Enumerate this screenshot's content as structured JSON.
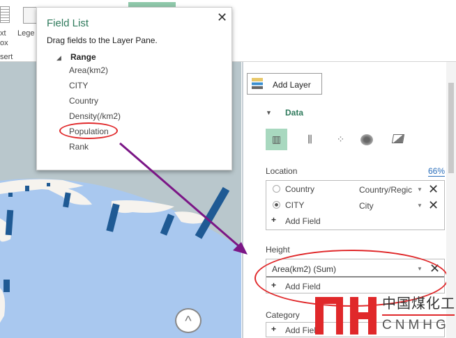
{
  "ribbon": {
    "text_box_label_1": "xt",
    "text_box_label_2": "ox",
    "legend_label": "Lege",
    "group_label": "sert"
  },
  "field_list": {
    "title": "Field List",
    "close": "✕",
    "description": "Drag fields to the Layer Pane.",
    "table_name": "Range",
    "fields": [
      "Area(km2)",
      "CITY",
      "Country",
      "Density(/km2)",
      "Population",
      "Rank"
    ]
  },
  "layer_pane": {
    "add_layer": "Add Layer",
    "data_section": "Data",
    "location_label": "Location",
    "location_confidence": "66%",
    "location_fields": [
      {
        "name": "Country",
        "type": "Country/Regic",
        "selected": false
      },
      {
        "name": "CITY",
        "type": "City",
        "selected": true
      }
    ],
    "add_field": "Add Field",
    "height_label": "Height",
    "height_field": "Area(km2) (Sum)",
    "category_label": "Category",
    "category_add_field": "Add Field"
  },
  "watermark": {
    "text_cn": "中国煤化工",
    "text_en": "CNMHG"
  },
  "colors": {
    "accent": "#2f7a5c",
    "selected_viz": "#a8d8bf",
    "column": "#1f5a94",
    "globe": "#a9c8ef",
    "annotation_red": "#e0282a",
    "arrow": "#7b1686"
  }
}
